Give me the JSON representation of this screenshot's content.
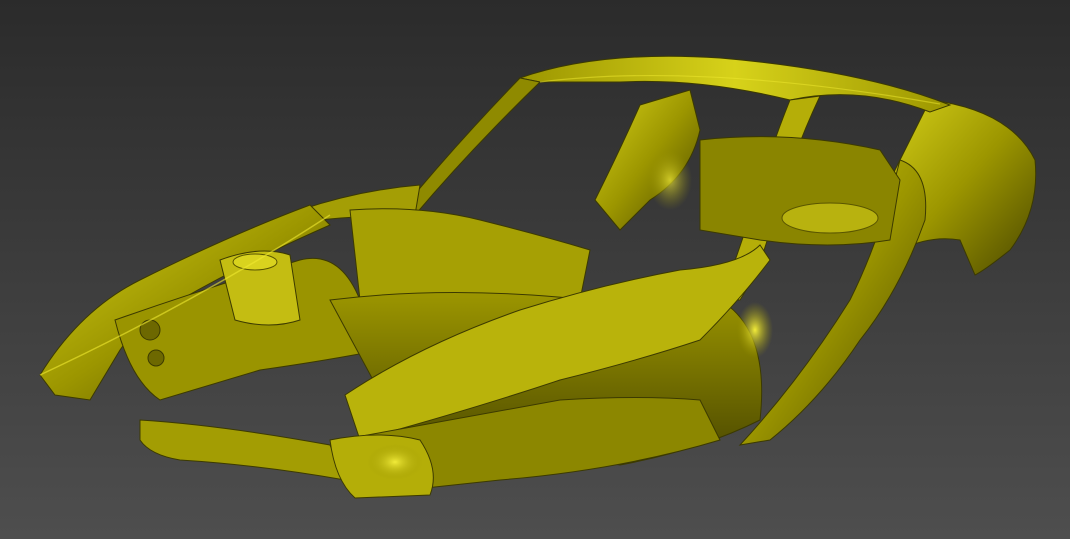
{
  "viewport": {
    "subject": "car-body-shell-3d-render",
    "colors": {
      "background_top": "#2b2b2b",
      "background_bottom": "#4e4e4e",
      "model_base": "#9c9600",
      "model_light": "#d7d21a",
      "model_dark": "#4a4700",
      "model_highlight": "#f2ec3a"
    }
  }
}
